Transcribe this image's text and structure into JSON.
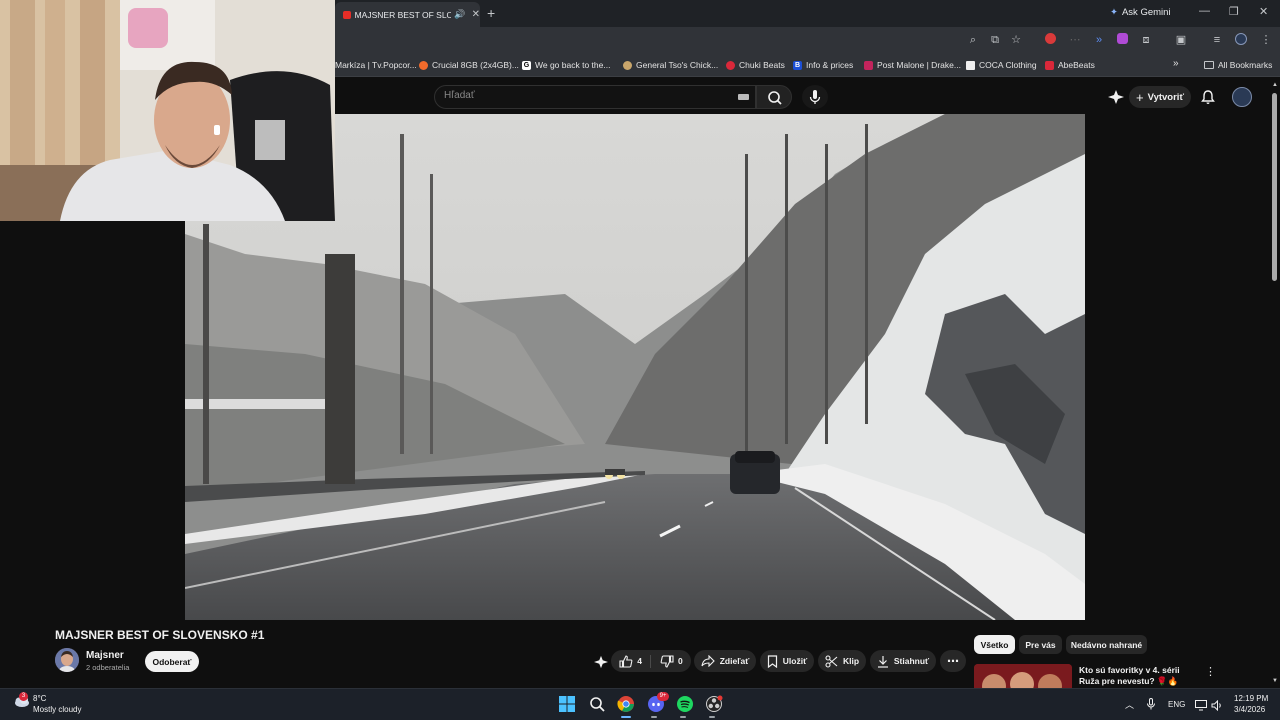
{
  "browser": {
    "tab_title": "MAJSNER BEST OF SLOVENSKO",
    "new_tab_label": "+",
    "gemini_label": "Ask Gemini",
    "bookmarks": [
      {
        "label": "Markíza | Tv.Popcor...",
        "color": "#3a3f45"
      },
      {
        "label": "Crucial 8GB (2x4GB)...",
        "color": "#f26b2b"
      },
      {
        "label": "We go back to the...",
        "color": "#ffffff"
      },
      {
        "label": "General Tso's Chick...",
        "color": "#c9a66b"
      },
      {
        "label": "Chuki Beats",
        "color": "#d9283a"
      },
      {
        "label": "Info & prices",
        "color": "#1c4fd6"
      },
      {
        "label": "Post Malone | Drake...",
        "color": "#c2245c"
      },
      {
        "label": "COCA Clothing",
        "color": "#eeeeee"
      },
      {
        "label": "AbeBeats",
        "color": "#d9283a"
      }
    ],
    "overflow_label": "»",
    "all_bookmarks_label": "All Bookmarks"
  },
  "youtube": {
    "search_placeholder": "Hľadať",
    "create_label": "Vytvoriť",
    "video_title": "MAJSNER BEST OF SLOVENSKO #1",
    "channel_name": "Majsner",
    "channel_subs": "2 odberatelia",
    "unsubscribe_label": "Odoberať",
    "likes": "4",
    "dislikes": "0",
    "share_label": "Zdieľať",
    "save_label": "Uložiť",
    "clip_label": "Klip",
    "download_label": "Stiahnuť",
    "chips": [
      "Všetko",
      "Pre vás",
      "Nedávno nahrané"
    ],
    "rec_title": "Kto sú favoritky v 4. sérii Ruža pre nevestu? 🌹🔥"
  },
  "taskbar": {
    "weather_badge": "3",
    "weather_temp": "8°C",
    "weather_desc": "Mostly cloudy",
    "discord_badge": "9+",
    "lang": "ENG",
    "time": "12:19 PM",
    "date": "3/4/2026"
  },
  "colors": {
    "youtube_bg": "#0f0f0f",
    "chrome_bg": "#303338",
    "accent_red": "#e52d27"
  }
}
